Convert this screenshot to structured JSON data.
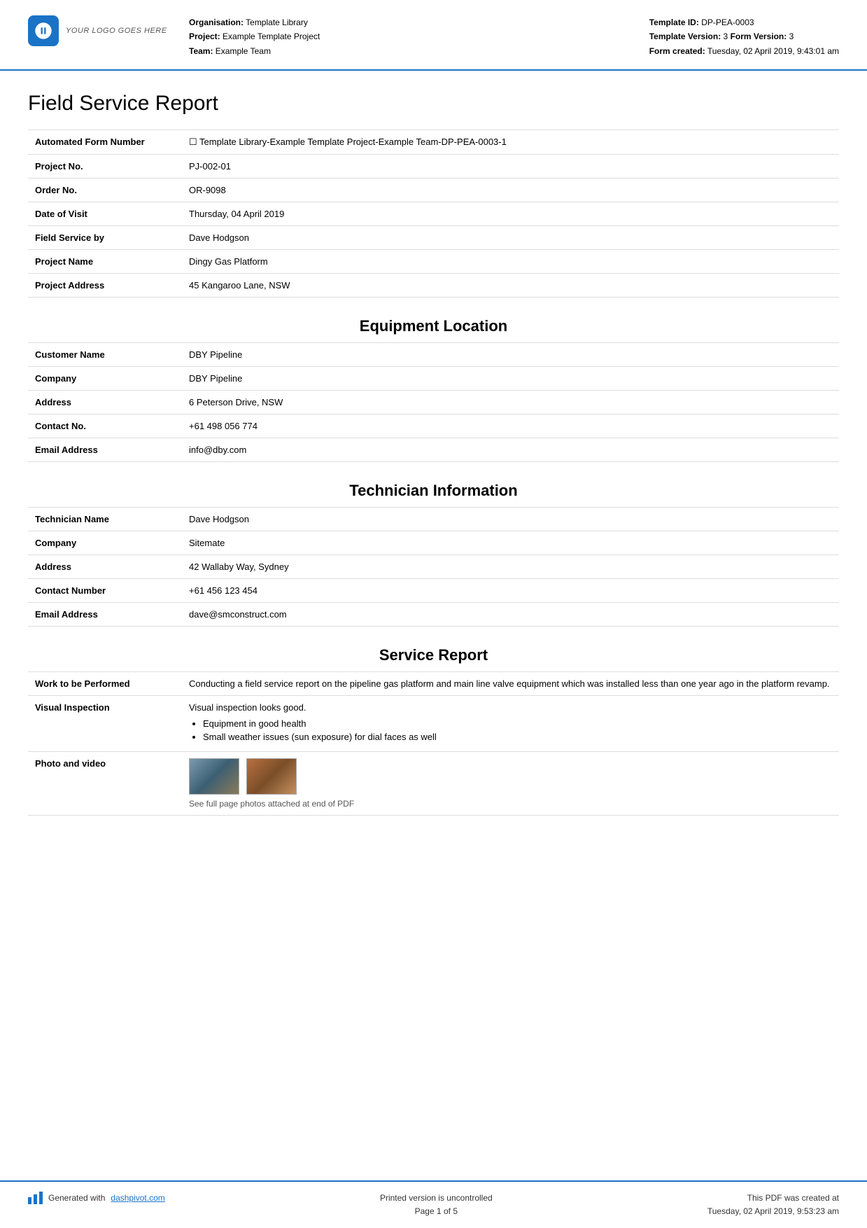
{
  "header": {
    "logo_text": "YOUR LOGO GOES HERE",
    "org_label": "Organisation:",
    "org_value": "Template Library",
    "project_label": "Project:",
    "project_value": "Example Template Project",
    "team_label": "Team:",
    "team_value": "Example Team",
    "template_id_label": "Template ID:",
    "template_id_value": "DP-PEA-0003",
    "template_version_label": "Template Version:",
    "template_version_value": "3",
    "form_version_label": "Form Version:",
    "form_version_value": "3",
    "form_created_label": "Form created:",
    "form_created_value": "Tuesday, 02 April 2019, 9:43:01 am"
  },
  "page_title": "Field Service Report",
  "form_fields": [
    {
      "label": "Automated Form Number",
      "value": "☐ Template Library-Example Template Project-Example Team-DP-PEA-0003-1"
    },
    {
      "label": "Project No.",
      "value": "PJ-002-01"
    },
    {
      "label": "Order No.",
      "value": "OR-9098"
    },
    {
      "label": "Date of Visit",
      "value": "Thursday, 04 April 2019"
    },
    {
      "label": "Field Service by",
      "value": "Dave Hodgson"
    },
    {
      "label": "Project Name",
      "value": "Dingy Gas Platform"
    },
    {
      "label": "Project Address",
      "value": "45 Kangaroo Lane, NSW"
    }
  ],
  "sections": [
    {
      "heading": "Equipment Location",
      "fields": [
        {
          "label": "Customer Name",
          "value": "DBY Pipeline"
        },
        {
          "label": "Company",
          "value": "DBY Pipeline"
        },
        {
          "label": "Address",
          "value": "6 Peterson Drive, NSW"
        },
        {
          "label": "Contact No.",
          "value": "+61 498 056 774"
        },
        {
          "label": "Email Address",
          "value": "info@dby.com"
        }
      ]
    },
    {
      "heading": "Technician Information",
      "fields": [
        {
          "label": "Technician Name",
          "value": "Dave Hodgson"
        },
        {
          "label": "Company",
          "value": "Sitemate"
        },
        {
          "label": "Address",
          "value": "42 Wallaby Way, Sydney"
        },
        {
          "label": "Contact Number",
          "value": "+61 456 123 454"
        },
        {
          "label": "Email Address",
          "value": "dave@smconstruct.com"
        }
      ]
    },
    {
      "heading": "Service Report",
      "fields": [
        {
          "label": "Work to be Performed",
          "value": "Conducting a field service report on the pipeline gas platform and main line valve equipment which was installed less than one year ago in the platform revamp.",
          "type": "text"
        },
        {
          "label": "Visual Inspection",
          "value": "Visual inspection looks good.",
          "type": "list",
          "list_items": [
            "Equipment in good health",
            "Small weather issues (sun exposure) for dial faces as well"
          ]
        },
        {
          "label": "Photo and video",
          "value": "",
          "type": "photos",
          "caption": "See full page photos attached at end of PDF"
        }
      ]
    }
  ],
  "footer": {
    "generated_text": "Generated with",
    "link_text": "dashpivot.com",
    "center_line1": "Printed version is uncontrolled",
    "center_line2": "Page 1 of 5",
    "right_line1": "This PDF was created at",
    "right_line2": "Tuesday, 02 April 2019, 9:53:23 am"
  }
}
